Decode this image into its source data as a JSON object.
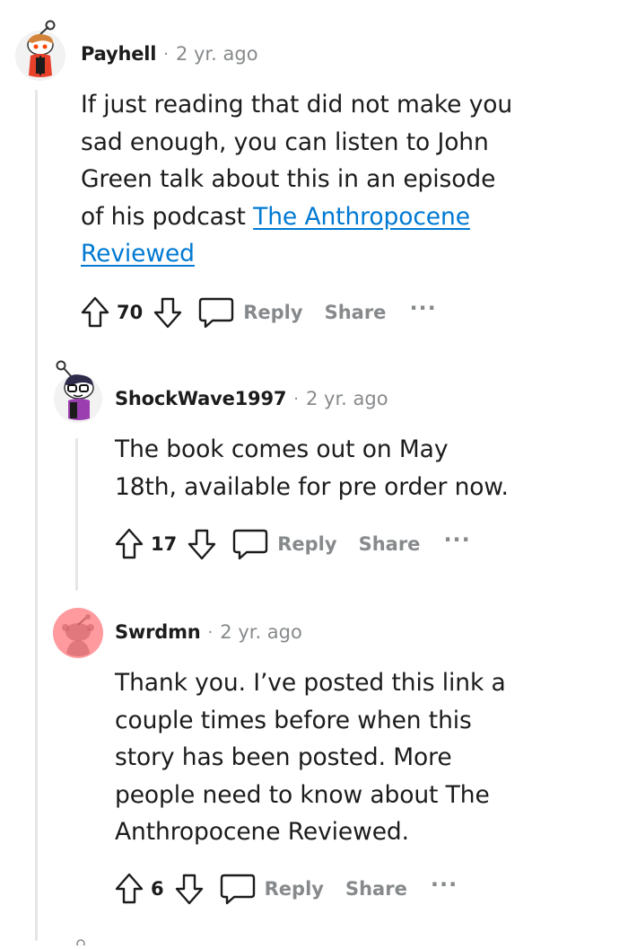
{
  "comments": [
    {
      "username": "Payhell",
      "separator": "·",
      "time": "2 yr. ago",
      "text_lines": [
        "If just reading that did not make you",
        "sad enough, you can listen to John",
        "Green talk about this in an episode",
        "of his podcast "
      ],
      "link_text_1": "The Anthropocene",
      "link_text_2": "Reviewed",
      "votes": "70",
      "reply": "Reply",
      "share": "Share",
      "more": "···"
    },
    {
      "username": "ShockWave1997",
      "separator": "·",
      "time": "2 yr. ago",
      "text_lines": [
        "The book comes out on May",
        "18th, available for pre order now."
      ],
      "votes": "17",
      "reply": "Reply",
      "share": "Share",
      "more": "···"
    },
    {
      "username": "Swrdmn",
      "separator": "·",
      "time": "2 yr. ago",
      "text_lines": [
        "Thank you. I’ve posted this link a",
        "couple times before when this",
        "story has been posted. More",
        "people need to know about The",
        "Anthropocene Reviewed."
      ],
      "votes": "6",
      "reply": "Reply",
      "share": "Share",
      "more": "···"
    }
  ],
  "icons": {
    "upvote": "upvote-arrow-icon",
    "downvote": "downvote-arrow-icon",
    "reply": "speech-bubble-icon"
  },
  "colors": {
    "link": "#0079d3",
    "meta": "#878a8c",
    "thread_line": "#e4e6e8",
    "avatar_pink": "#ff9a9e"
  }
}
